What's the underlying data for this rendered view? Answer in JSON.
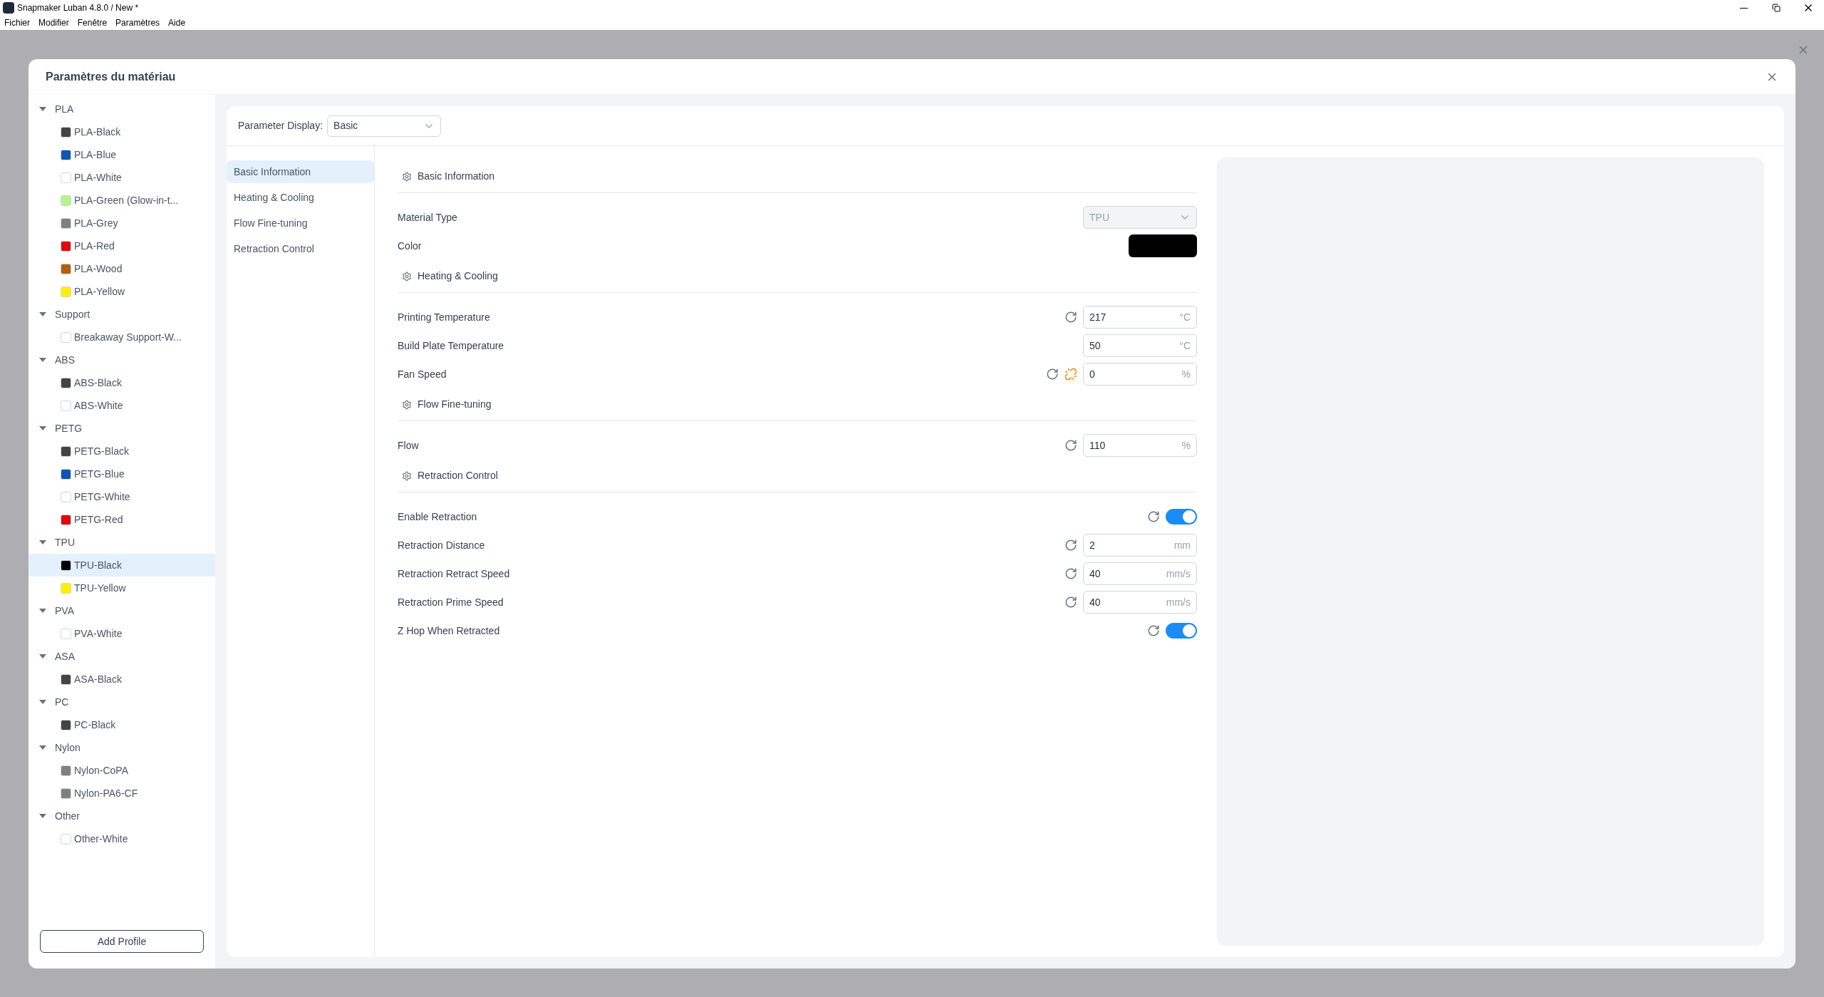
{
  "window": {
    "title": "Snapmaker Luban 4.8.0 / New *"
  },
  "menu": [
    "Fichier",
    "Modifier",
    "Fenêtre",
    "Paramètres",
    "Aide"
  ],
  "dialog": {
    "title": "Paramètres du matériau"
  },
  "sidebar": {
    "groups": [
      {
        "label": "PLA",
        "expanded": true,
        "children": [
          {
            "label": "PLA-Black",
            "color": "#444444",
            "selected": false
          },
          {
            "label": "PLA-Blue",
            "color": "#0b55b5",
            "selected": false
          },
          {
            "label": "PLA-White",
            "color": "#ffffff",
            "selected": false
          },
          {
            "label": "PLA-Green (Glow-in-t...",
            "color": "#b5f58a",
            "selected": false
          },
          {
            "label": "PLA-Grey",
            "color": "#808080",
            "selected": false
          },
          {
            "label": "PLA-Red",
            "color": "#e0090b",
            "selected": false
          },
          {
            "label": "PLA-Wood",
            "color": "#b06010",
            "selected": false
          },
          {
            "label": "PLA-Yellow",
            "color": "#fff000",
            "selected": false
          }
        ]
      },
      {
        "label": "Support",
        "expanded": true,
        "children": [
          {
            "label": "Breakaway Support-W...",
            "color": "#ffffff",
            "selected": false
          }
        ]
      },
      {
        "label": "ABS",
        "expanded": true,
        "children": [
          {
            "label": "ABS-Black",
            "color": "#444444",
            "selected": false
          },
          {
            "label": "ABS-White",
            "color": "#ffffff",
            "selected": false
          }
        ]
      },
      {
        "label": "PETG",
        "expanded": true,
        "children": [
          {
            "label": "PETG-Black",
            "color": "#444444",
            "selected": false
          },
          {
            "label": "PETG-Blue",
            "color": "#0b55b5",
            "selected": false
          },
          {
            "label": "PETG-White",
            "color": "#ffffff",
            "selected": false
          },
          {
            "label": "PETG-Red",
            "color": "#e0090b",
            "selected": false
          }
        ]
      },
      {
        "label": "TPU",
        "expanded": true,
        "children": [
          {
            "label": "TPU-Black",
            "color": "#000000",
            "selected": true
          },
          {
            "label": "TPU-Yellow",
            "color": "#fff000",
            "selected": false
          }
        ]
      },
      {
        "label": "PVA",
        "expanded": true,
        "children": [
          {
            "label": "PVA-White",
            "color": "#ffffff",
            "selected": false
          }
        ]
      },
      {
        "label": "ASA",
        "expanded": true,
        "children": [
          {
            "label": "ASA-Black",
            "color": "#444444",
            "selected": false
          }
        ]
      },
      {
        "label": "PC",
        "expanded": true,
        "children": [
          {
            "label": "PC-Black",
            "color": "#444444",
            "selected": false
          }
        ]
      },
      {
        "label": "Nylon",
        "expanded": true,
        "children": [
          {
            "label": "Nylon-CoPA",
            "color": "#808080",
            "selected": false
          },
          {
            "label": "Nylon-PA6-CF",
            "color": "#808080",
            "selected": false
          }
        ]
      },
      {
        "label": "Other",
        "expanded": true,
        "children": [
          {
            "label": "Other-White",
            "color": "#ffffff",
            "selected": false
          }
        ]
      }
    ],
    "add_button": "Add Profile"
  },
  "parameter_display": {
    "label": "Parameter Display:",
    "value": "Basic"
  },
  "nav": [
    {
      "label": "Basic Information",
      "selected": true
    },
    {
      "label": "Heating & Cooling",
      "selected": false
    },
    {
      "label": "Flow Fine-tuning",
      "selected": false
    },
    {
      "label": "Retraction Control",
      "selected": false
    }
  ],
  "sections": [
    {
      "title": "Basic Information",
      "rows": [
        {
          "kind": "select",
          "label": "Material Type",
          "value": "TPU",
          "disabled": true
        },
        {
          "kind": "color",
          "label": "Color",
          "color": "#000000"
        }
      ]
    },
    {
      "title": "Heating & Cooling",
      "rows": [
        {
          "kind": "input",
          "label": "Printing Temperature",
          "value": "217",
          "unit": "°C",
          "reset": true,
          "unlinked": false
        },
        {
          "kind": "input",
          "label": "Build Plate Temperature",
          "value": "50",
          "unit": "°C",
          "reset": false,
          "unlinked": false
        },
        {
          "kind": "input",
          "label": "Fan Speed",
          "value": "0",
          "unit": "%",
          "reset": true,
          "unlinked": true
        }
      ]
    },
    {
      "title": "Flow Fine-tuning",
      "rows": [
        {
          "kind": "input",
          "label": "Flow",
          "value": "110",
          "unit": "%",
          "reset": true,
          "unlinked": false
        }
      ]
    },
    {
      "title": "Retraction Control",
      "rows": [
        {
          "kind": "toggle",
          "label": "Enable Retraction",
          "on": true,
          "reset": true
        },
        {
          "kind": "input",
          "label": "Retraction Distance",
          "value": "2",
          "unit": "mm",
          "reset": true,
          "unlinked": false
        },
        {
          "kind": "input",
          "label": "Retraction Retract Speed",
          "value": "40",
          "unit": "mm/s",
          "reset": true,
          "unlinked": false
        },
        {
          "kind": "input",
          "label": "Retraction Prime Speed",
          "value": "40",
          "unit": "mm/s",
          "reset": true,
          "unlinked": false
        },
        {
          "kind": "toggle",
          "label": "Z Hop When Retracted",
          "on": true,
          "reset": true
        }
      ]
    }
  ]
}
